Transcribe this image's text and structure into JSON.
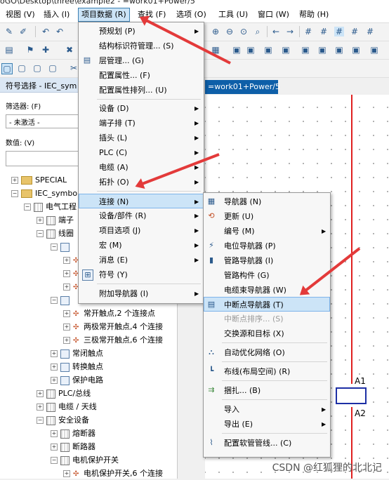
{
  "window_title": "oGO\\Desktop\\three\\example2 - =work01+Power/5",
  "menubar": [
    "视图 (V)",
    "插入 (I)",
    "项目数据 (R)",
    "查找 (F)",
    "选项 (O)",
    "工具 (U)",
    "窗口 (W)",
    "帮助 (H)"
  ],
  "left_panel": {
    "title": "符号选择 - IEC_sym",
    "filter_label": "筛选器: (F)",
    "filter_value": "- 未激活 -",
    "value_label": "数值: (V)",
    "tree": [
      {
        "label": "SPECIAL"
      },
      {
        "label": "IEC_symbo"
      },
      {
        "label": "电气工程"
      },
      {
        "label": "端子"
      },
      {
        "label": "线圈"
      },
      {
        "label": "常开触点,2 个连接点"
      },
      {
        "label": "两极常开触点,4 个连接"
      },
      {
        "label": "三极常开触点,6 个连接"
      },
      {
        "label": "常闭触点"
      },
      {
        "label": "转换触点"
      },
      {
        "label": "保护电路"
      },
      {
        "label": "PLC/总线"
      },
      {
        "label": "电缆 / 天线"
      },
      {
        "label": "安全设备"
      },
      {
        "label": "熔断器"
      },
      {
        "label": "断路器"
      },
      {
        "label": "电机保护开关"
      },
      {
        "label": "电机保护开关,6 个连接"
      }
    ]
  },
  "document_tab": "=work01+Power/5",
  "canvas_labels": {
    "a1": "A1",
    "a2": "A2"
  },
  "project_menu": {
    "items": [
      {
        "label": "预规划 (P)",
        "submenu": true
      },
      {
        "label": "结构标识符管理... (S)",
        "submenu": false
      },
      {
        "label": "层管理... (G)",
        "submenu": false
      },
      {
        "label": "配置属性... (F)",
        "submenu": false
      },
      {
        "label": "配置属性排列... (U)",
        "submenu": false
      },
      {
        "label": "设备 (D)",
        "submenu": true
      },
      {
        "label": "端子排 (T)",
        "submenu": true
      },
      {
        "label": "插头 (L)",
        "submenu": true
      },
      {
        "label": "PLC (C)",
        "submenu": true
      },
      {
        "label": "电缆 (A)",
        "submenu": true
      },
      {
        "label": "拓扑 (O)",
        "submenu": true
      },
      {
        "label": "连接 (N)",
        "submenu": true
      },
      {
        "label": "设备/部件 (R)",
        "submenu": true
      },
      {
        "label": "项目选项 (J)",
        "submenu": true
      },
      {
        "label": "宏 (M)",
        "submenu": true
      },
      {
        "label": "消息 (E)",
        "submenu": true
      },
      {
        "label": "符号 (Y)",
        "submenu": false
      },
      {
        "label": "附加导航器 (I)",
        "submenu": true
      }
    ]
  },
  "connection_submenu": {
    "items": [
      {
        "label": "导航器 (N)",
        "submenu": false
      },
      {
        "label": "更新 (U)",
        "submenu": false
      },
      {
        "label": "编号 (M)",
        "submenu": true
      },
      {
        "label": "电位导航器 (P)",
        "submenu": false
      },
      {
        "label": "管路导航器 (I)",
        "submenu": false
      },
      {
        "label": "管路构件 (G)",
        "submenu": false
      },
      {
        "label": "电缆束导航器 (W)",
        "submenu": false
      },
      {
        "label": "中断点导航器 (T)",
        "submenu": false
      },
      {
        "label": "中断点排序... (S)",
        "submenu": false,
        "disabled": true
      },
      {
        "label": "交换源和目标 (X)",
        "submenu": false
      },
      {
        "label": "自动优化网络 (O)",
        "submenu": false
      },
      {
        "label": "布线(布局空间) (R)",
        "submenu": false
      },
      {
        "label": "捆扎... (B)",
        "submenu": false
      },
      {
        "label": "导入",
        "submenu": true
      },
      {
        "label": "导出 (E)",
        "submenu": true
      },
      {
        "label": "配置软管管线... (C)",
        "submenu": false
      }
    ]
  },
  "watermark": "CSDN @红狐狸的北北记",
  "colors": {
    "accent": "#0e5fa8",
    "highlight": "#cce4f7",
    "arrow": "#e33a3a",
    "wire": "#e02020"
  }
}
